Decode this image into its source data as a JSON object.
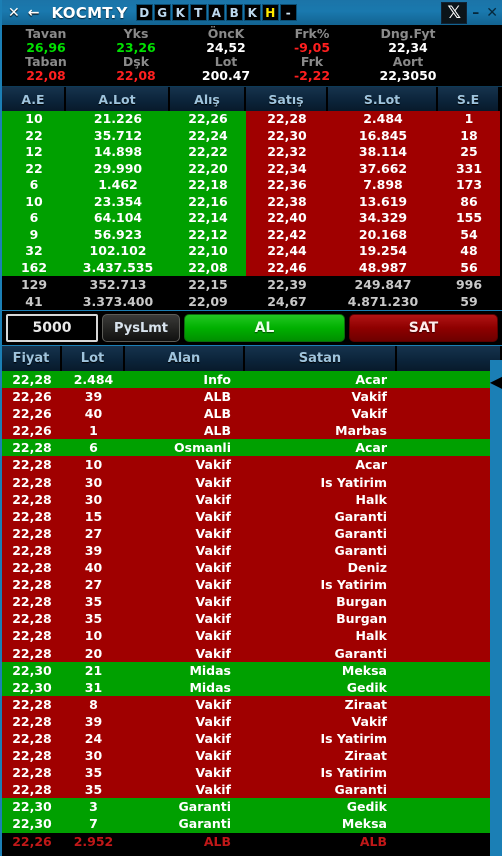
{
  "titlebar": {
    "close_glyph": "✕",
    "back_glyph": "←",
    "symbol": "KOCMT.Y",
    "letter_buttons": [
      "D",
      "G",
      "K",
      "T",
      "A",
      "B",
      "K",
      "H",
      "-"
    ],
    "highlight_letter": "H",
    "x_logo": "𝕏",
    "minimize_glyph": "–",
    "close_right_glyph": "✕"
  },
  "stats": {
    "labels_row1": [
      "Tavan",
      "Yks",
      "ÖncK",
      "Frk%",
      "Dng.Fyt"
    ],
    "values_row1": [
      "26,96",
      "23,26",
      "24,52",
      "-9,05",
      "22,34"
    ],
    "labels_row2": [
      "Taban",
      "Dşk",
      "Lot",
      "Frk",
      "Aort"
    ],
    "values_row2": [
      "22,08",
      "22,08",
      "200.47",
      "-2,22",
      "22,3050"
    ]
  },
  "orderbook": {
    "headers": [
      "A.E",
      "A.Lot",
      "Alış",
      "Satış",
      "S.Lot",
      "S.E"
    ],
    "rows": [
      {
        "ae": "10",
        "alot": "21.226",
        "alis": "22,26",
        "satis": "22,28",
        "slot": "2.484",
        "se": "1"
      },
      {
        "ae": "22",
        "alot": "35.712",
        "alis": "22,24",
        "satis": "22,30",
        "slot": "16.845",
        "se": "18"
      },
      {
        "ae": "12",
        "alot": "14.898",
        "alis": "22,22",
        "satis": "22,32",
        "slot": "38.114",
        "se": "25"
      },
      {
        "ae": "22",
        "alot": "29.990",
        "alis": "22,20",
        "satis": "22,34",
        "slot": "37.662",
        "se": "331"
      },
      {
        "ae": "6",
        "alot": "1.462",
        "alis": "22,18",
        "satis": "22,36",
        "slot": "7.898",
        "se": "173"
      },
      {
        "ae": "10",
        "alot": "23.354",
        "alis": "22,16",
        "satis": "22,38",
        "slot": "13.619",
        "se": "86"
      },
      {
        "ae": "6",
        "alot": "64.104",
        "alis": "22,14",
        "satis": "22,40",
        "slot": "34.329",
        "se": "155"
      },
      {
        "ae": "9",
        "alot": "56.923",
        "alis": "22,12",
        "satis": "22,42",
        "slot": "20.168",
        "se": "54"
      },
      {
        "ae": "32",
        "alot": "102.102",
        "alis": "22,10",
        "satis": "22,44",
        "slot": "19.254",
        "se": "48"
      },
      {
        "ae": "162",
        "alot": "3.437.535",
        "alis": "22,08",
        "satis": "22,46",
        "slot": "48.987",
        "se": "56"
      }
    ],
    "summary": [
      {
        "ae": "129",
        "alot": "352.713",
        "alis": "22,15",
        "satis": "22,39",
        "slot": "249.847",
        "se": "996"
      },
      {
        "ae": "41",
        "alot": "3.373.400",
        "alis": "22,09",
        "satis": "24,67",
        "slot": "4.871.230",
        "se": "59"
      }
    ]
  },
  "order_entry": {
    "quantity": "5000",
    "order_type": "PysLmt",
    "buy_label": "AL",
    "sell_label": "SAT"
  },
  "trades": {
    "headers": [
      "Fiyat",
      "Lot",
      "Alan",
      "Satan"
    ],
    "rows": [
      {
        "fiyat": "22,28",
        "lot": "2.484",
        "alan": "Info",
        "satan": "Acar",
        "dir": "up"
      },
      {
        "fiyat": "22,26",
        "lot": "39",
        "alan": "ALB",
        "satan": "Vakif",
        "dir": "down"
      },
      {
        "fiyat": "22,26",
        "lot": "40",
        "alan": "ALB",
        "satan": "Vakif",
        "dir": "down"
      },
      {
        "fiyat": "22,26",
        "lot": "1",
        "alan": "ALB",
        "satan": "Marbas",
        "dir": "down"
      },
      {
        "fiyat": "22,28",
        "lot": "6",
        "alan": "Osmanli",
        "satan": "Acar",
        "dir": "up"
      },
      {
        "fiyat": "22,28",
        "lot": "10",
        "alan": "Vakif",
        "satan": "Acar",
        "dir": "down"
      },
      {
        "fiyat": "22,28",
        "lot": "30",
        "alan": "Vakif",
        "satan": "Is Yatirim",
        "dir": "down"
      },
      {
        "fiyat": "22,28",
        "lot": "30",
        "alan": "Vakif",
        "satan": "Halk",
        "dir": "down"
      },
      {
        "fiyat": "22,28",
        "lot": "15",
        "alan": "Vakif",
        "satan": "Garanti",
        "dir": "down"
      },
      {
        "fiyat": "22,28",
        "lot": "27",
        "alan": "Vakif",
        "satan": "Garanti",
        "dir": "down"
      },
      {
        "fiyat": "22,28",
        "lot": "39",
        "alan": "Vakif",
        "satan": "Garanti",
        "dir": "down"
      },
      {
        "fiyat": "22,28",
        "lot": "40",
        "alan": "Vakif",
        "satan": "Deniz",
        "dir": "down"
      },
      {
        "fiyat": "22,28",
        "lot": "27",
        "alan": "Vakif",
        "satan": "Is Yatirim",
        "dir": "down"
      },
      {
        "fiyat": "22,28",
        "lot": "35",
        "alan": "Vakif",
        "satan": "Burgan",
        "dir": "down"
      },
      {
        "fiyat": "22,28",
        "lot": "35",
        "alan": "Vakif",
        "satan": "Burgan",
        "dir": "down"
      },
      {
        "fiyat": "22,28",
        "lot": "10",
        "alan": "Vakif",
        "satan": "Halk",
        "dir": "down"
      },
      {
        "fiyat": "22,28",
        "lot": "20",
        "alan": "Vakif",
        "satan": "Garanti",
        "dir": "down"
      },
      {
        "fiyat": "22,30",
        "lot": "21",
        "alan": "Midas",
        "satan": "Meksa",
        "dir": "up"
      },
      {
        "fiyat": "22,30",
        "lot": "31",
        "alan": "Midas",
        "satan": "Gedik",
        "dir": "up"
      },
      {
        "fiyat": "22,28",
        "lot": "8",
        "alan": "Vakif",
        "satan": "Ziraat",
        "dir": "down"
      },
      {
        "fiyat": "22,28",
        "lot": "39",
        "alan": "Vakif",
        "satan": "Vakif",
        "dir": "down"
      },
      {
        "fiyat": "22,28",
        "lot": "24",
        "alan": "Vakif",
        "satan": "Is Yatirim",
        "dir": "down"
      },
      {
        "fiyat": "22,28",
        "lot": "30",
        "alan": "Vakif",
        "satan": "Ziraat",
        "dir": "down"
      },
      {
        "fiyat": "22,28",
        "lot": "35",
        "alan": "Vakif",
        "satan": "Is Yatirim",
        "dir": "down"
      },
      {
        "fiyat": "22,28",
        "lot": "35",
        "alan": "Vakif",
        "satan": "Garanti",
        "dir": "down"
      },
      {
        "fiyat": "22,30",
        "lot": "3",
        "alan": "Garanti",
        "satan": "Gedik",
        "dir": "up"
      },
      {
        "fiyat": "22,30",
        "lot": "7",
        "alan": "Garanti",
        "satan": "Meksa",
        "dir": "up"
      },
      {
        "fiyat": "22,26",
        "lot": "2.952",
        "alan": "ALB",
        "satan": "ALB",
        "dir": "none"
      }
    ]
  },
  "scroll": {
    "arrow_glyph": "◀"
  },
  "colors": {
    "bid_green": "#00a000",
    "ask_red": "#a00000",
    "accent_blue": "#1b7fb5",
    "up_text": "#00e000",
    "down_text": "#ff1f1f"
  }
}
